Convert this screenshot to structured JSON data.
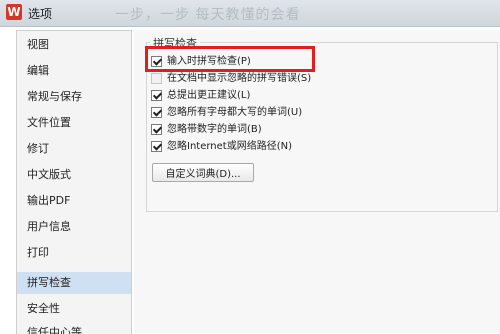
{
  "window": {
    "title": "选项",
    "logo_letter": "W",
    "background_text": "一步，一步     每天教懂的会看"
  },
  "sidebar": {
    "items": [
      {
        "label": "视图"
      },
      {
        "label": "编辑"
      },
      {
        "label": "常规与保存"
      },
      {
        "label": "文件位置"
      },
      {
        "label": "修订"
      },
      {
        "label": "中文版式"
      },
      {
        "label": "输出PDF"
      },
      {
        "label": "用户信息"
      },
      {
        "label": "打印"
      },
      {
        "label": "拼写检查",
        "active": true
      },
      {
        "label": "安全性"
      },
      {
        "label": "信任中心等"
      }
    ]
  },
  "spell": {
    "group_title": "拼写检查",
    "options": [
      {
        "label": "输入时拼写检查(P)",
        "checked": true,
        "enabled": true
      },
      {
        "label": "在文档中显示忽略的拼写错误(S)",
        "checked": false,
        "enabled": false
      },
      {
        "label": "总提出更正建议(L)",
        "checked": true,
        "enabled": true
      },
      {
        "label": "忽略所有字母都大写的单词(U)",
        "checked": true,
        "enabled": true
      },
      {
        "label": "忽略带数字的单词(B)",
        "checked": true,
        "enabled": true
      },
      {
        "label": "忽略Internet或网络路径(N)",
        "checked": true,
        "enabled": true
      }
    ],
    "dictionary_button": "自定义词典(D)..."
  },
  "colors": {
    "highlight": "#e21d1d",
    "active_nav": "#cfe0f2",
    "logo": "#d8352a"
  }
}
